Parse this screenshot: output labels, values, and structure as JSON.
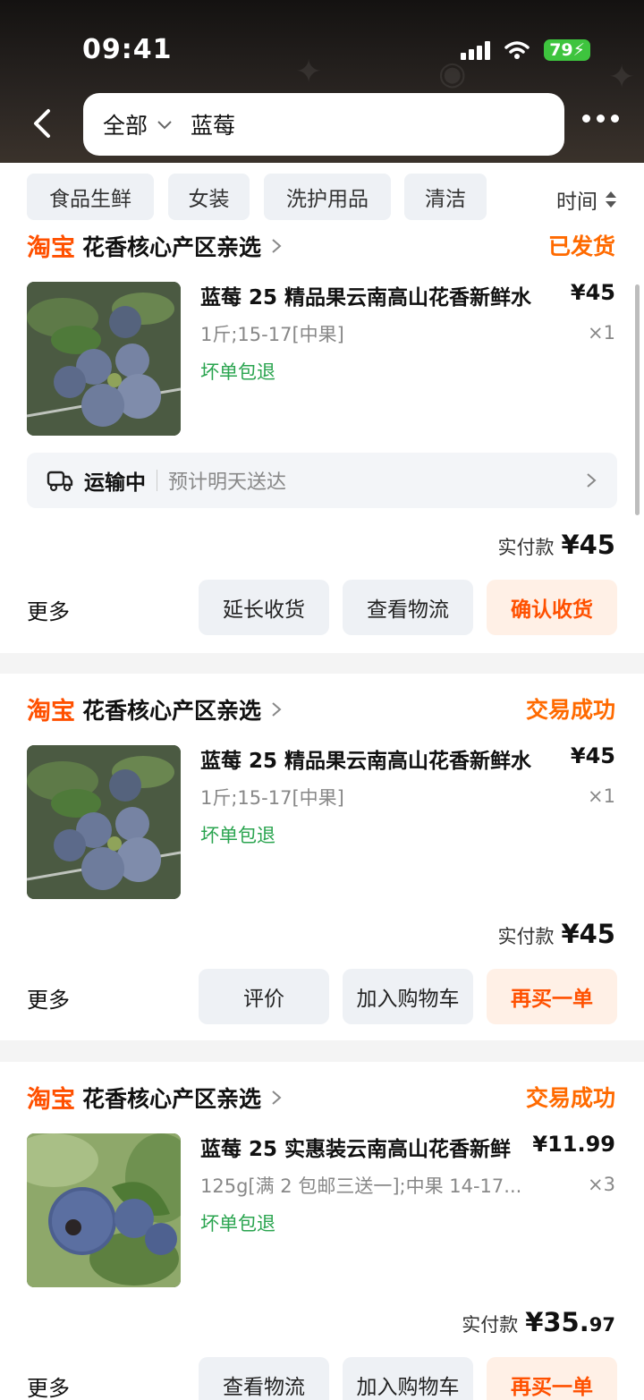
{
  "status_bar": {
    "time": "09:41",
    "battery": "79"
  },
  "search": {
    "scope": "全部",
    "query": "蓝莓"
  },
  "filters": {
    "chips": [
      "食品生鲜",
      "女装",
      "洗护用品",
      "清洁"
    ],
    "sort_label": "时间"
  },
  "orders": [
    {
      "brand": "淘宝",
      "shop": "花香核心产区亲选",
      "status": "已发货",
      "title": "蓝莓 25 精品果云南高山花香新鲜水",
      "price": "¥45",
      "spec": "1斤;15-17[中果]",
      "qty": "×1",
      "guarantee": "坏单包退",
      "shipping": {
        "status": "运输中",
        "eta": "预计明天送达"
      },
      "paid_label": "实付款",
      "paid_amount": "¥45",
      "paid_cents": "",
      "more": "更多",
      "buttons": [
        "延长收货",
        "查看物流",
        "确认收货"
      ]
    },
    {
      "brand": "淘宝",
      "shop": "花香核心产区亲选",
      "status": "交易成功",
      "title": "蓝莓 25 精品果云南高山花香新鲜水",
      "price": "¥45",
      "spec": "1斤;15-17[中果]",
      "qty": "×1",
      "guarantee": "坏单包退",
      "paid_label": "实付款",
      "paid_amount": "¥45",
      "paid_cents": "",
      "more": "更多",
      "buttons": [
        "评价",
        "加入购物车",
        "再买一单"
      ]
    },
    {
      "brand": "淘宝",
      "shop": "花香核心产区亲选",
      "status": "交易成功",
      "title": "蓝莓 25 实惠装云南高山花香新鲜",
      "price": "¥11.99",
      "spec": "125g[满 2 包邮三送一];中果 14-17...",
      "qty": "×3",
      "guarantee": "坏单包退",
      "paid_label": "实付款",
      "paid_amount": "¥35.",
      "paid_cents": "97",
      "more": "更多",
      "buttons": [
        "查看物流",
        "加入购物车",
        "再买一单"
      ]
    }
  ],
  "colors": {
    "brand_orange": "#ff5000",
    "guarantee_green": "#2aa44f",
    "status_orange": "#ff6a00"
  }
}
